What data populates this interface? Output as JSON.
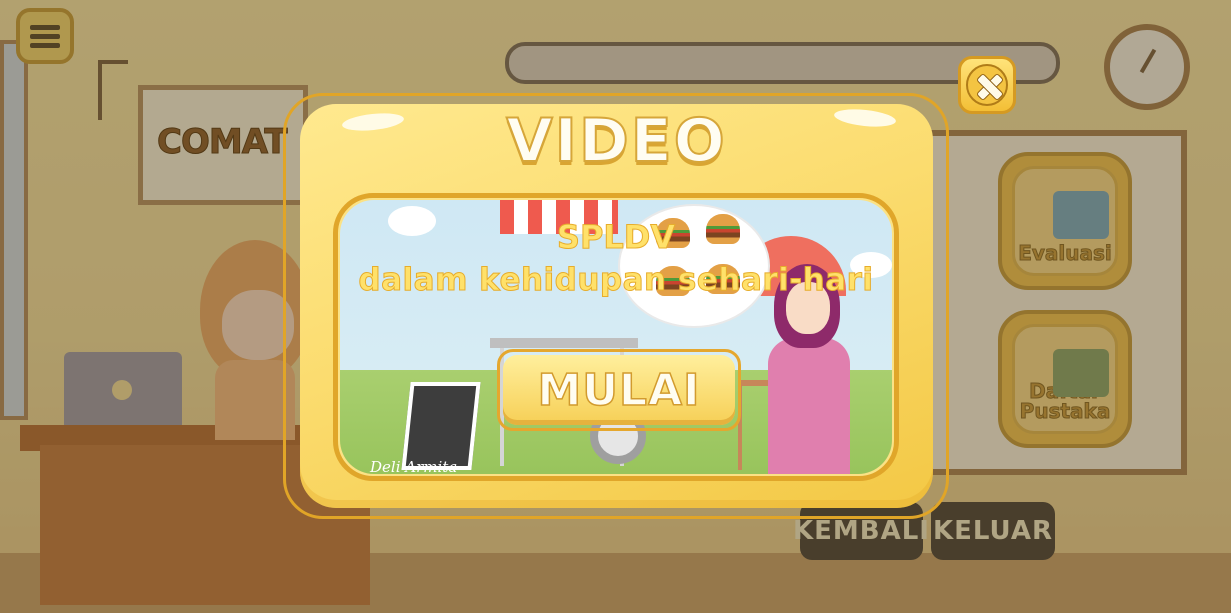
{
  "background": {
    "sign_text": "COMAT",
    "tiles": [
      {
        "label": "Evaluasi",
        "icon": "books-clock-icon"
      },
      {
        "label": "Daftar Pustaka",
        "icon": "books-icon"
      }
    ],
    "buttons": {
      "kembali": "KEMBALI",
      "keluar": "KELUAR"
    }
  },
  "modal": {
    "title": "VIDEO",
    "close_icon": "close-icon",
    "video": {
      "title_line1": "SPLDV",
      "title_line2": "dalam kehidupan sehari-hari",
      "start_label": "MULAI",
      "signature": "Deli Armita"
    }
  },
  "colors": {
    "modal_fill": "#fbdc6f",
    "modal_border": "#e1a527",
    "title_text": "#fffdf2",
    "video_title": "#ffe16a",
    "dark_button": "#4b4338"
  }
}
